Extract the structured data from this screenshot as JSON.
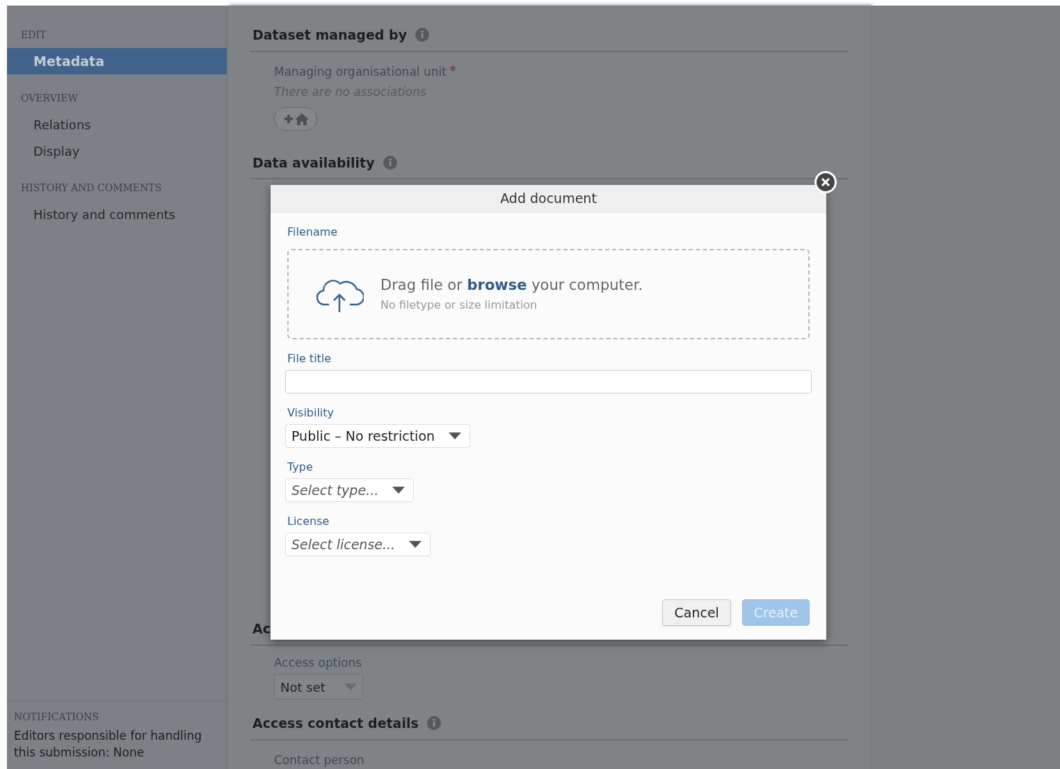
{
  "sidebar": {
    "sections": [
      {
        "heading": "EDIT",
        "items": [
          {
            "label": "Metadata",
            "selected": true
          }
        ]
      },
      {
        "heading": "OVERVIEW",
        "items": [
          {
            "label": "Relations",
            "selected": false
          },
          {
            "label": "Display",
            "selected": false
          }
        ]
      },
      {
        "heading": "HISTORY AND COMMENTS",
        "items": [
          {
            "label": "History and comments",
            "selected": false
          }
        ]
      }
    ],
    "notifications": {
      "heading": "NOTIFICATIONS",
      "text": "Editors responsible for handling this submission: None"
    }
  },
  "main": {
    "sections": [
      {
        "title": "Dataset managed by",
        "info": true,
        "fields": [
          {
            "kind": "association",
            "label": "Managing organisational unit",
            "required_mark": "*",
            "empty_text": "There are no associations"
          }
        ]
      },
      {
        "title": "Data availability",
        "info": true
      },
      {
        "title": "Ac",
        "fields": [
          {
            "kind": "select",
            "label": "Access options",
            "value": "Not set"
          }
        ]
      },
      {
        "title": "Access contact details",
        "info": true,
        "fields": [
          {
            "kind": "label",
            "label": "Contact person"
          }
        ]
      }
    ]
  },
  "dialog": {
    "title": "Add document",
    "fields": [
      {
        "kind": "upload",
        "label": "Filename",
        "text_before": "Drag file or",
        "link": "browse",
        "text_after": "your computer.",
        "hint": "No filetype or size limitation"
      },
      {
        "kind": "text",
        "label": "File title"
      },
      {
        "kind": "select",
        "label": "Visibility",
        "value": "Public – No restriction"
      },
      {
        "kind": "select",
        "label": "Type",
        "placeholder": "Select type..."
      },
      {
        "kind": "select",
        "label": "License",
        "placeholder": "Select license..."
      }
    ],
    "buttons": [
      {
        "label": "Cancel",
        "disabled": false
      },
      {
        "label": "Create",
        "disabled": true
      }
    ]
  }
}
